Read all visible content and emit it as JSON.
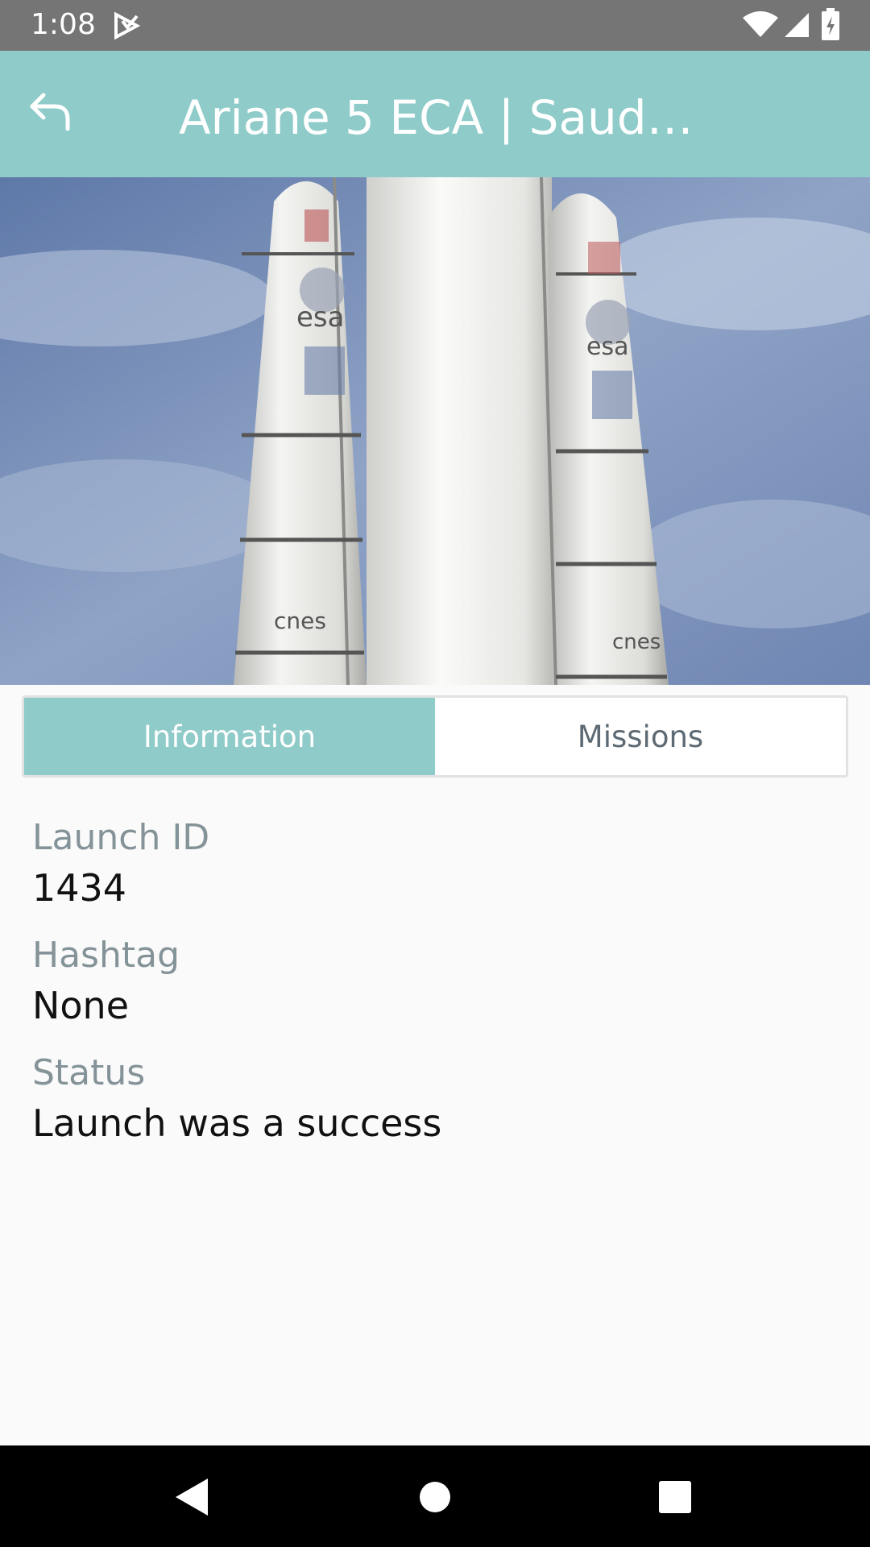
{
  "status_bar": {
    "time": "1:08",
    "icons": [
      "notification-icon",
      "wifi-icon",
      "signal-icon",
      "battery-icon"
    ]
  },
  "app_bar": {
    "title": "Ariane 5 ECA | Saudi…",
    "back_icon": "back-arrow-icon",
    "background_color": "#8ecbc9"
  },
  "hero_image": {
    "description_icon": "rocket-photo"
  },
  "tabs": [
    {
      "label": "Information",
      "selected": true
    },
    {
      "label": "Missions",
      "selected": false
    }
  ],
  "fields": [
    {
      "label": "Launch ID",
      "value": "1434"
    },
    {
      "label": "Hashtag",
      "value": "None"
    },
    {
      "label": "Status",
      "value": "Launch was a success"
    }
  ],
  "nav_bar": {
    "icons": [
      "back-triangle-icon",
      "home-circle-icon",
      "recents-square-icon"
    ]
  }
}
